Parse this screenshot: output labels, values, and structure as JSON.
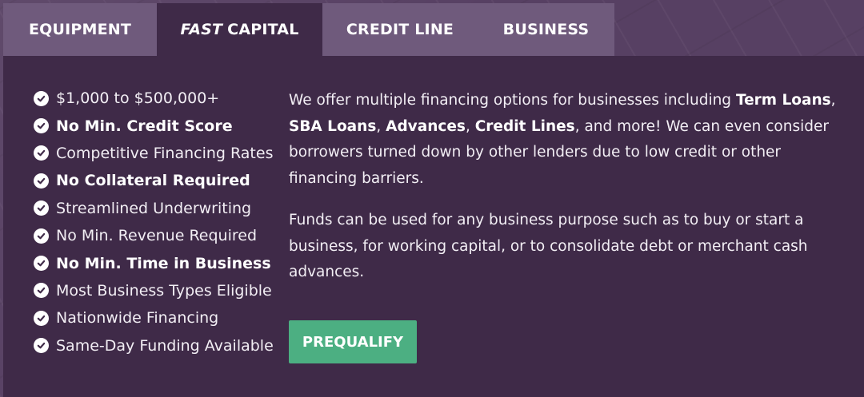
{
  "tabs": [
    {
      "label": "EQUIPMENT",
      "emphasis": ""
    },
    {
      "label": "CAPITAL",
      "emphasis": "FAST"
    },
    {
      "label": "CREDIT LINE",
      "emphasis": ""
    },
    {
      "label": "BUSINESS",
      "emphasis": ""
    }
  ],
  "active_tab": 1,
  "features": [
    {
      "text": "$1,000 to $500,000+",
      "bold": false
    },
    {
      "text": "No Min. Credit Score",
      "bold": true
    },
    {
      "text": "Competitive Financing Rates",
      "bold": false
    },
    {
      "text": "No Collateral Required",
      "bold": true
    },
    {
      "text": "Streamlined Underwriting",
      "bold": false
    },
    {
      "text": "No Min. Revenue Required",
      "bold": false
    },
    {
      "text": "No Min. Time in Business",
      "bold": true
    },
    {
      "text": "Most Business Types Eligible",
      "bold": false
    },
    {
      "text": "Nationwide Financing",
      "bold": false
    },
    {
      "text": "Same-Day Funding Available",
      "bold": false
    }
  ],
  "content": {
    "p1": {
      "intro": "We offer multiple financing options for businesses including ",
      "term_loans": "Term Loans",
      "sep1": ", ",
      "sba_loans": "SBA Loans",
      "sep2": ", ",
      "advances": "Advances",
      "sep3": ", ",
      "credit_lines": "Credit Lines",
      "outro": ", and more! We can even consider borrowers turned down by other lenders due to low credit or other financing barriers."
    },
    "p2": "Funds can be used for any business purpose such as to buy or start a business, for working capital, or to consolidate debt or merchant cash advances."
  },
  "button": {
    "label": "PREQUALIFY"
  },
  "colors": {
    "panel": "#3f2a48",
    "tab_inactive": "#6f5a7c",
    "button": "#4caf82",
    "text": "#f2eef4"
  },
  "icons": {
    "feature_bullet": "check-circle-icon"
  }
}
